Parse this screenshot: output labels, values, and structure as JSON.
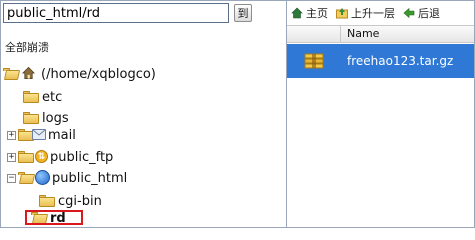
{
  "path_bar": {
    "value": "public_html/rd",
    "go_label": "到"
  },
  "tree_header": {
    "collapse_all": "全部崩溃"
  },
  "tree": {
    "root": "(/home/xqblogco)",
    "etc": "etc",
    "logs": "logs",
    "mail": "mail",
    "public_ftp": "public_ftp",
    "public_html": "public_html",
    "cgi_bin": "cgi-bin",
    "rd": "rd"
  },
  "toolbar": {
    "home": "主页",
    "up_level": "上升一层",
    "back": "后退"
  },
  "file_list": {
    "columns": [
      "",
      "Name"
    ],
    "rows": [
      {
        "name": "freehao123.tar.gz",
        "icon": "archive-icon",
        "selected": true
      }
    ]
  },
  "colors": {
    "selection": "#2f78d6",
    "highlight_border": "#d9191c",
    "folder": "#e9c055"
  }
}
